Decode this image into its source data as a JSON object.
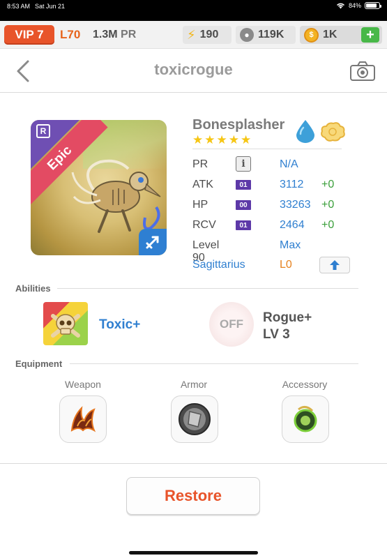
{
  "status_bar": {
    "time": "8:53 AM",
    "date": "Sat Jun 21",
    "battery": "84%",
    "battery_level": 0.84
  },
  "topbar": {
    "vip": "VIP 7",
    "level": "L70",
    "power": "1.3M",
    "power_unit": "PR",
    "energy": "190",
    "paws": "119K",
    "coins": "1K",
    "add_label": "+"
  },
  "nav": {
    "title": "toxicrogue"
  },
  "monster": {
    "rarity": "Epic",
    "rarity_letter": "R",
    "name": "Bonesplasher",
    "star_count": 5,
    "elements": [
      "water-drop-icon",
      "cloud-icon"
    ],
    "stats": [
      {
        "label": "PR",
        "badge": "",
        "value": "N/A",
        "bonus": ""
      },
      {
        "label": "ATK",
        "badge": "01",
        "value": "3112",
        "bonus": "+0"
      },
      {
        "label": "HP",
        "badge": "00",
        "value": "33263",
        "bonus": "+0"
      },
      {
        "label": "RCV",
        "badge": "01",
        "value": "2464",
        "bonus": "+0"
      }
    ],
    "level_label": "Level 90",
    "level_status": "Max",
    "zodiac": "Sagittarius",
    "zodiac_level": "L0",
    "info_glyph": "i"
  },
  "abilities": {
    "title": "Abilities",
    "active_name": "Toxic+",
    "passive_state": "OFF",
    "passive_name": "Rogue+",
    "passive_level": "LV 3"
  },
  "equipment": {
    "title": "Equipment",
    "slots": [
      "Weapon",
      "Armor",
      "Accessory"
    ]
  },
  "actions": {
    "restore": "Restore"
  },
  "colors": {
    "accent": "#e8542a",
    "link": "#2f7fd0",
    "epic": "#e34b63",
    "badge": "#5d39a8"
  }
}
